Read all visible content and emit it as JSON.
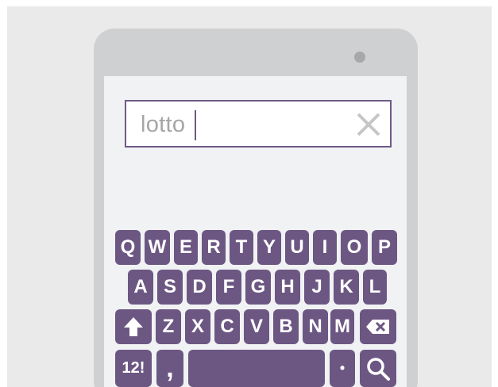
{
  "search": {
    "query": "lotto",
    "clear_icon": "close-icon"
  },
  "keyboard": {
    "row1": [
      "Q",
      "W",
      "E",
      "R",
      "T",
      "Y",
      "U",
      "I",
      "O",
      "P"
    ],
    "row2": [
      "A",
      "S",
      "D",
      "F",
      "G",
      "H",
      "J",
      "K",
      "L"
    ],
    "row3": [
      "Z",
      "X",
      "C",
      "V",
      "B",
      "N",
      "M"
    ],
    "shift_icon": "shift-up-arrow-icon",
    "backspace_icon": "backspace-icon",
    "symbols_label": "12!",
    "comma_label": ",",
    "period_label": "•",
    "search_key_icon": "search-icon",
    "key_color": "#6c5783"
  },
  "colors": {
    "accent": "#6e5a86",
    "device": "#cfd0d2",
    "screen": "#f1f2f4"
  }
}
